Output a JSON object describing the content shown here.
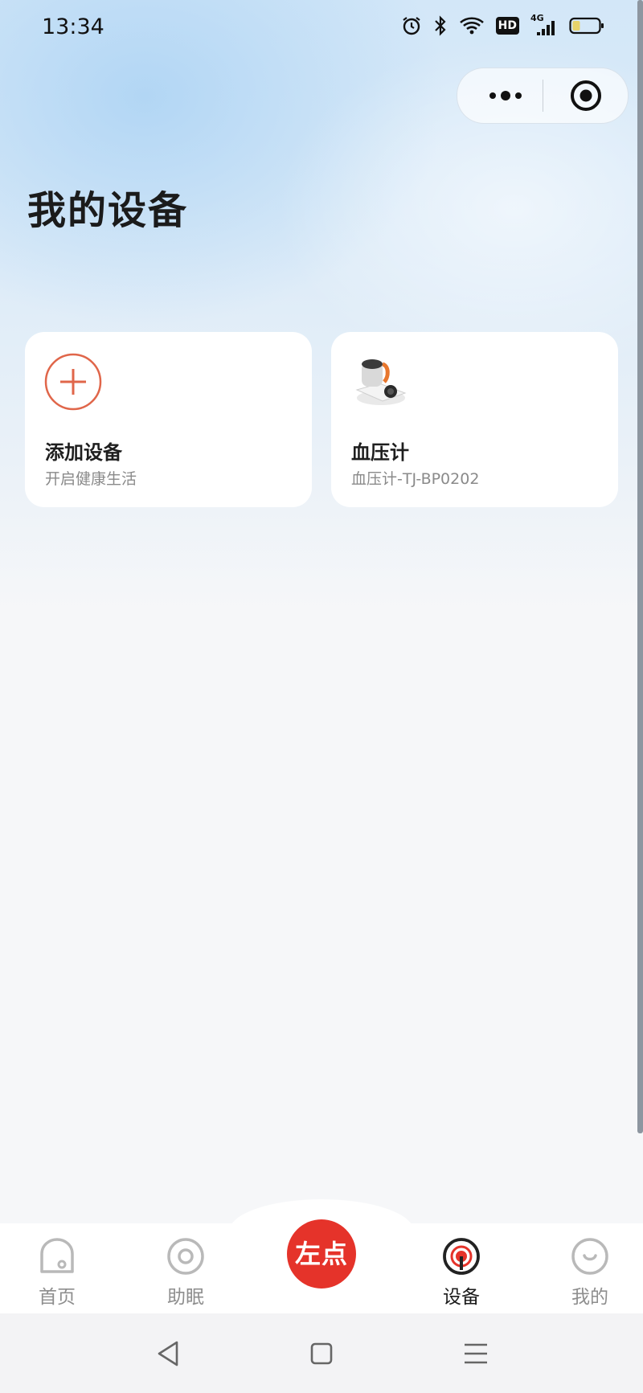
{
  "status_bar": {
    "time": "13:34",
    "hd_badge": "HD",
    "network": "4G"
  },
  "page": {
    "title": "我的设备"
  },
  "devices": [
    {
      "title": "添加设备",
      "subtitle": "开启健康生活",
      "icon": "add-circle-icon"
    },
    {
      "title": "血压计",
      "subtitle": "血压计-TJ-BP0202",
      "icon": "blood-pressure-monitor-image"
    }
  ],
  "tabbar": {
    "tabs": [
      {
        "label": "首页",
        "icon": "home-icon"
      },
      {
        "label": "助眠",
        "icon": "sleep-icon"
      },
      {
        "label": "设备",
        "icon": "device-icon",
        "active": true
      },
      {
        "label": "我的",
        "icon": "profile-icon"
      }
    ],
    "center_label": "左点"
  },
  "colors": {
    "accent": "#e5332a",
    "add_icon": "#e0664a"
  }
}
